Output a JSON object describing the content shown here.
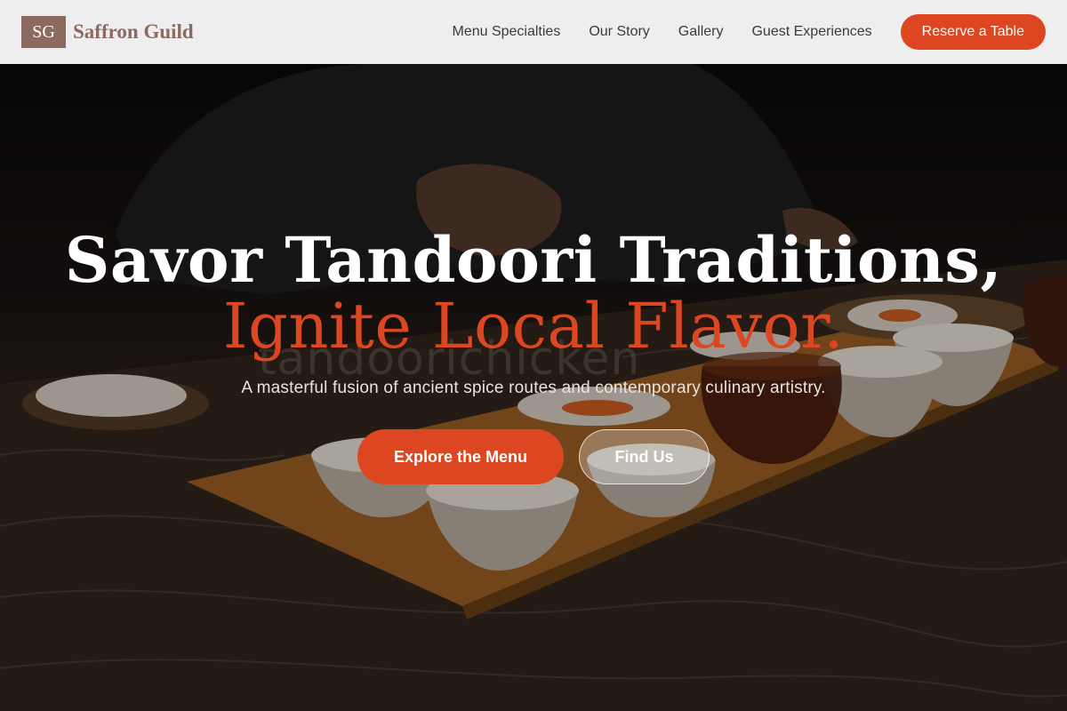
{
  "brand": {
    "logo_initials": "SG",
    "name": "Saffron Guild"
  },
  "nav": {
    "items": [
      {
        "label": "Menu Specialties"
      },
      {
        "label": "Our Story"
      },
      {
        "label": "Gallery"
      },
      {
        "label": "Guest Experiences"
      }
    ],
    "cta_label": "Reserve a Table"
  },
  "hero": {
    "headline_line1": "Savor Tandoori Traditions,",
    "headline_line2": "Ignite Local Flavor.",
    "ghost_text": "tandoorichicken",
    "subtitle": "A masterful fusion of ancient spice routes and contemporary culinary artistry.",
    "primary_cta": "Explore the Menu",
    "secondary_cta": "Find Us"
  },
  "colors": {
    "accent": "#dc4620",
    "brand": "#8c6a60",
    "header_bg": "#eeeeee"
  }
}
